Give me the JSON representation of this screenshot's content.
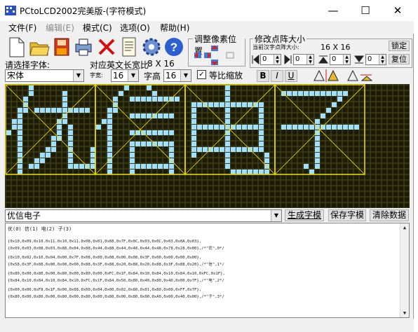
{
  "window": {
    "title": "PCtoLCD2002完美版-(字符模式)",
    "controls": [
      "—",
      "☐",
      "✕"
    ]
  },
  "menu": [
    {
      "label": "文件(F)",
      "enabled": true
    },
    {
      "label": "编辑(E)",
      "enabled": false
    },
    {
      "label": "模式(C)",
      "enabled": true
    },
    {
      "label": "选项(O)",
      "enabled": true
    },
    {
      "label": "帮助(H)",
      "enabled": true
    }
  ],
  "toolbar": {
    "icons": [
      "new-file-icon",
      "open-folder-icon",
      "save-disk-icon",
      "print-icon",
      "delete-icon",
      "notes-icon",
      "settings-gear-icon",
      "help-icon"
    ]
  },
  "pixel_pos": {
    "title": "调整像素位置"
  },
  "matrix": {
    "title": "修改点阵大小",
    "current_label": "当前汉字点阵大小:",
    "current_value": "16 X 16",
    "lock_label": "锁定",
    "restore_label": "复位",
    "spins": [
      "0",
      "0",
      "0",
      "0"
    ]
  },
  "font": {
    "choose_label": "请选择字体:",
    "width_label": "对应英文长宽比",
    "width_value": "8 X 16",
    "font_name": "宋体",
    "char_width_label": "字宽:",
    "char_width": "16",
    "char_height_label": "字高",
    "char_height": "16",
    "proportional_label": "等比缩放",
    "proportional_checked": true
  },
  "style_buttons": [
    "B",
    "I",
    "U"
  ],
  "input": {
    "text": "优信电子",
    "generate_label": "生成字模",
    "save_label": "保存字模",
    "clear_label": "清除数据"
  },
  "output": {
    "header": "优(0) 信(1) 电(2) 子(3)",
    "lines": [
      "{0x10,0x09,0x10,0x11,0x10,0x11,0x08,0x01,0x88,0x7F,0x0C,0x03,0x0C,0x03,0x0A,0x03},",
      "{0x09,0x03,0x08,0x03,0x88,0x04,0x88,0x44,0x88,0x44,0x48,0x44,0x48,0x78,0x28,0x00},/*\"优\",0*/",
      "",
      "{0x10,0x02,0x10,0x04,0x00,0x7F,0x08,0x00,0x08,0x00,0x08,0x3F,0x00,0x00,0x00,0x00},",
      "{0x58,0x3F,0x08,0x00,0x08,0x00,0x88,0x3F,0x88,0x20,0x88,0x20,0x88,0x3F,0x88,0x20},/*\"信\",1*/",
      "",
      "{0x80,0x00,0x80,0x00,0x80,0x00,0x80,0x00,0xFC,0x1F,0x84,0x10,0x84,0x10,0x84,0x10,0xFC,0x1F},",
      "{0x84,0x10,0x84,0x10,0x84,0x10,0xFC,0x1F,0x84,0x50,0x80,0x40,0x80,0x40,0x00,0x7F},/*\"电\",2*/",
      "",
      "{0x00,0x00,0xF8,0x1F,0x00,0x08,0x00,0x04,0x00,0x02,0x80,0x01,0x80,0x00,0xFF,0x7F},",
      "{0x80,0x00,0x80,0x00,0x80,0x00,0x80,0x00,0x80,0x00,0x80,0x00,0xA0,0x00,0x40,0x00},/*\"子\",3*/"
    ]
  },
  "colors": {
    "grid_background": "#1c1c08",
    "lit_pixel": "#a3e0ff",
    "grid_line": "#4c4c1a",
    "char_frame": "#f0e000"
  },
  "glyph_grid": {
    "cols": 16,
    "rows": 16,
    "glyphs": [
      [
        "0000100000000000",
        "0000100000100000",
        "0001000000100000",
        "0001000000100000",
        "0011011111111110",
        "0010000000100000",
        "0110000001100000",
        "0110000001010000",
        "1010000001010000",
        "0010000011010000",
        "0010000010010000",
        "0010000110010001",
        "0010001100010001",
        "0010011000010001",
        "0010110000011111",
        "0010000000000000"
      ],
      [
        "0000010001000000",
        "0000100000100000",
        "0001001111111110",
        "0001000000000000",
        "0011000000000000",
        "0010001111111100",
        "0110000000000000",
        "1010000000000000",
        "0010001111111100",
        "0010000000000000",
        "0010001111111100",
        "0010001000000100",
        "0010001000000100",
        "0010001000000100",
        "0010001111111100",
        "0010001000000100"
      ],
      [
        "0000000100000000",
        "0000000100000000",
        "0000000100000000",
        "0111111111111100",
        "0100000100000100",
        "0100000100000100",
        "0100000100000100",
        "0111111111111100",
        "0100000100000100",
        "0100000100000100",
        "0100000100000100",
        "0111111111111100",
        "0100000100000010",
        "0000000100000010",
        "0000000100000010",
        "0000000011111110"
      ],
      [
        "0000000000000000",
        "0111111111111000",
        "0000000000010000",
        "0000000000100000",
        "0000000001000000",
        "0000000010000000",
        "0000000100000000",
        "0111111111111110",
        "0000000100000000",
        "0000000100000000",
        "0000000100000000",
        "0000000100000000",
        "0000000100000000",
        "0000000100000000",
        "0000010100000000",
        "0000001000000000"
      ]
    ]
  }
}
